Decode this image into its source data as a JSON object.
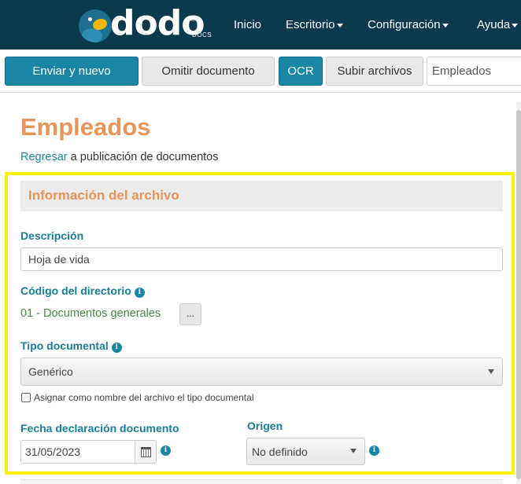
{
  "brand": {
    "name": "dodo",
    "sub": "DOCS",
    "reg": "®"
  },
  "nav": {
    "items": [
      {
        "label": "Inicio"
      },
      {
        "label": "Escritorio"
      },
      {
        "label": "Configuración"
      },
      {
        "label": "Ayuda"
      }
    ]
  },
  "toolbar": {
    "send_new": "Enviar y nuevo",
    "skip": "Omitir documento",
    "ocr": "OCR",
    "upload": "Subir archivos",
    "category_select": "Empleados"
  },
  "page": {
    "title": "Empleados",
    "back_link": "Regresar",
    "back_text": " a publicación de documentos"
  },
  "form": {
    "panel_title": "Información del archivo",
    "description_label": "Descripción",
    "description_value": "Hoja de vida",
    "directory_label": "Código del directorio",
    "directory_value": "01 - Documentos generales",
    "directory_button": "...",
    "doctype_label": "Tipo documental",
    "doctype_value": "Genérico",
    "assign_checkbox_label": "Asignar como nombre del archivo el tipo documental",
    "assign_checked": false,
    "date_label": "Fecha declaración documento",
    "date_value": "31/05/2023",
    "origin_label": "Origen",
    "origin_value": "No definido",
    "info_glyph": "i"
  },
  "colors": {
    "navbar": "#0b3a4e",
    "primary": "#1a86a6",
    "title_orange": "#e9955a",
    "label_teal": "#1a7d96",
    "highlight": "#fff200"
  }
}
